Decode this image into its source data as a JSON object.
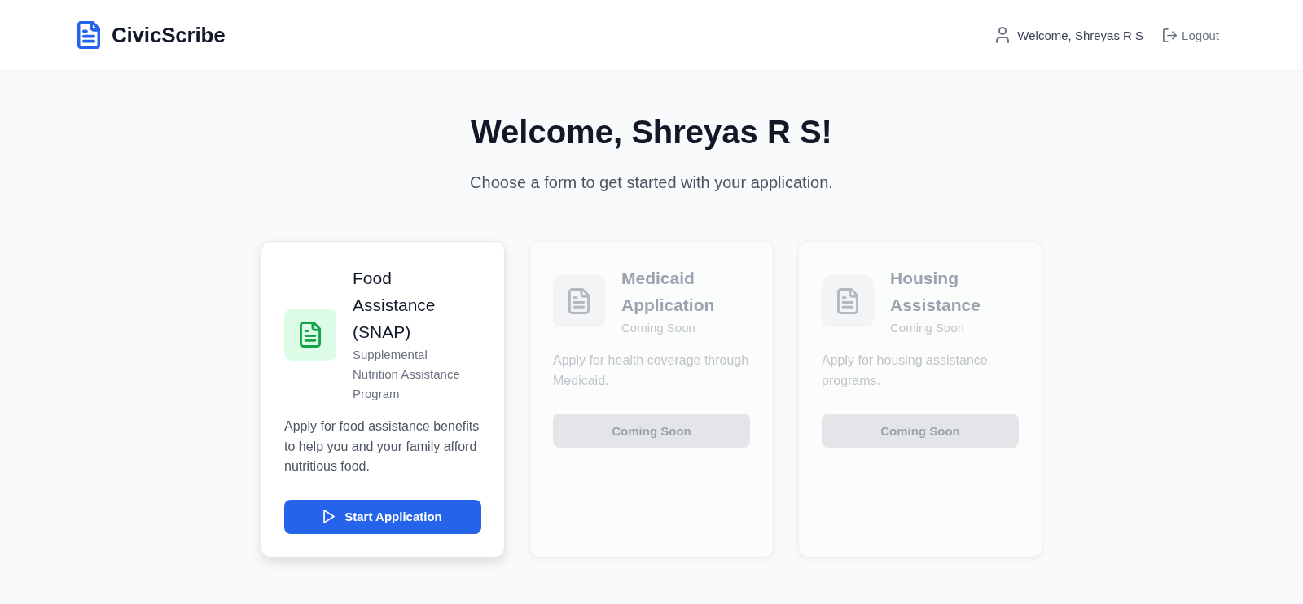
{
  "header": {
    "logo": "CivicScribe",
    "user_greeting": "Welcome, Shreyas R S",
    "logout": "Logout"
  },
  "hero": {
    "title": "Welcome, Shreyas R S!",
    "subtitle": "Choose a form to get started with your application."
  },
  "forms": [
    {
      "title": "Food Assistance (SNAP)",
      "subtitle": "Supplemental Nutrition Assistance Program",
      "description": "Apply for food assistance benefits to help you and your family afford nutritious food.",
      "button": "Start Application",
      "disabled": false
    },
    {
      "title": "Medicaid Application",
      "subtitle": "Coming Soon",
      "description": "Apply for health coverage through Medicaid.",
      "button": "Coming Soon",
      "disabled": true
    },
    {
      "title": "Housing Assistance",
      "subtitle": "Coming Soon",
      "description": "Apply for housing assistance programs.",
      "button": "Coming Soon",
      "disabled": true
    }
  ]
}
